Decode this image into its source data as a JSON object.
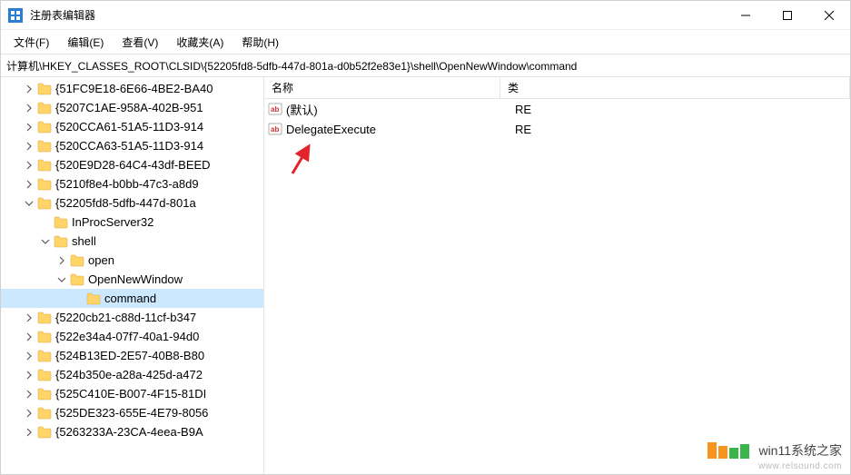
{
  "titlebar": {
    "title": "注册表编辑器"
  },
  "menu": {
    "file": "文件(F)",
    "edit": "编辑(E)",
    "view": "查看(V)",
    "favorites": "收藏夹(A)",
    "help": "帮助(H)"
  },
  "address": "计算机\\HKEY_CLASSES_ROOT\\CLSID\\{52205fd8-5dfb-447d-801a-d0b52f2e83e1}\\shell\\OpenNewWindow\\command",
  "tree": [
    {
      "indent": 1,
      "twisty": ">",
      "label": "{51FC9E18-6E66-4BE2-BA40"
    },
    {
      "indent": 1,
      "twisty": ">",
      "label": "{5207C1AE-958A-402B-951"
    },
    {
      "indent": 1,
      "twisty": ">",
      "label": "{520CCA61-51A5-11D3-914"
    },
    {
      "indent": 1,
      "twisty": ">",
      "label": "{520CCA63-51A5-11D3-914"
    },
    {
      "indent": 1,
      "twisty": ">",
      "label": "{520E9D28-64C4-43df-BEED"
    },
    {
      "indent": 1,
      "twisty": ">",
      "label": "{5210f8e4-b0bb-47c3-a8d9"
    },
    {
      "indent": 1,
      "twisty": "v",
      "label": "{52205fd8-5dfb-447d-801a"
    },
    {
      "indent": 2,
      "twisty": "",
      "label": "InProcServer32"
    },
    {
      "indent": 2,
      "twisty": "v",
      "label": "shell"
    },
    {
      "indent": 3,
      "twisty": ">",
      "label": "open"
    },
    {
      "indent": 3,
      "twisty": "v",
      "label": "OpenNewWindow"
    },
    {
      "indent": 4,
      "twisty": "",
      "label": "command",
      "selected": true
    },
    {
      "indent": 1,
      "twisty": ">",
      "label": "{5220cb21-c88d-11cf-b347"
    },
    {
      "indent": 1,
      "twisty": ">",
      "label": "{522e34a4-07f7-40a1-94d0"
    },
    {
      "indent": 1,
      "twisty": ">",
      "label": "{524B13ED-2E57-40B8-B80"
    },
    {
      "indent": 1,
      "twisty": ">",
      "label": "{524b350e-a28a-425d-a472"
    },
    {
      "indent": 1,
      "twisty": ">",
      "label": "{525C410E-B007-4F15-81DI"
    },
    {
      "indent": 1,
      "twisty": ">",
      "label": "{525DE323-655E-4E79-8056"
    },
    {
      "indent": 1,
      "twisty": ">",
      "label": "{5263233A-23CA-4eea-B9A"
    }
  ],
  "valuesHeader": {
    "name": "名称",
    "type": "类"
  },
  "values": [
    {
      "name": "(默认)",
      "type": "RE"
    },
    {
      "name": "DelegateExecute",
      "type": "RE"
    }
  ],
  "watermark": {
    "brand": "win11系统之家",
    "url": "www.relsound.com"
  }
}
